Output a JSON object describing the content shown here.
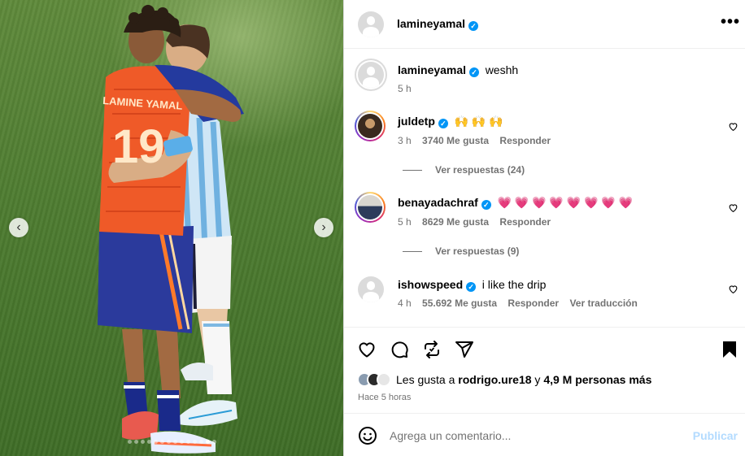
{
  "post": {
    "author": "lamineyamal",
    "verified": true,
    "more_label": "•••",
    "image": {
      "jersey_text": "LAMINE YAMAL",
      "jersey_number": "19",
      "nav_prev": "‹",
      "nav_next": "›",
      "dot_count": 14,
      "active_dot": 12
    }
  },
  "caption": {
    "username": "lamineyamal",
    "text": "weshh",
    "time": "5 h"
  },
  "comments": [
    {
      "username": "juldetp",
      "verified": true,
      "text": "🙌 🙌 🙌",
      "time": "3 h",
      "likes": "3740 Me gusta",
      "reply_label": "Responder",
      "view_replies": "Ver respuestas (24)"
    },
    {
      "username": "benayadachraf",
      "verified": true,
      "text": "💗 💗 💗 💗 💗 💗 💗 💗",
      "time": "5 h",
      "likes": "8629 Me gusta",
      "reply_label": "Responder",
      "view_replies": "Ver respuestas (9)"
    },
    {
      "username": "ishowspeed",
      "verified": true,
      "text": "i like the drip",
      "time": "4 h",
      "likes": "55.692 Me gusta",
      "reply_label": "Responder",
      "translate_label": "Ver traducción"
    }
  ],
  "actions": {
    "likes_prefix": "Les gusta a ",
    "likes_user": "rodrigo.ure18",
    "likes_middle": " y ",
    "likes_others": "4,9 M personas más",
    "posted_ago": "Hace 5 horas"
  },
  "composer": {
    "placeholder": "Agrega un comentario...",
    "publish_label": "Publicar"
  },
  "icons": {
    "like": "heart-icon",
    "comment": "comment-icon",
    "repost": "repost-icon",
    "share": "share-icon",
    "save": "bookmark-icon",
    "emoji": "emoji-icon",
    "more": "more-options-icon"
  },
  "colors": {
    "verified_blue": "#0095f6",
    "publish_disabled": "#b3dbff",
    "secondary_text": "#737373",
    "grass": "#4e7c31"
  }
}
